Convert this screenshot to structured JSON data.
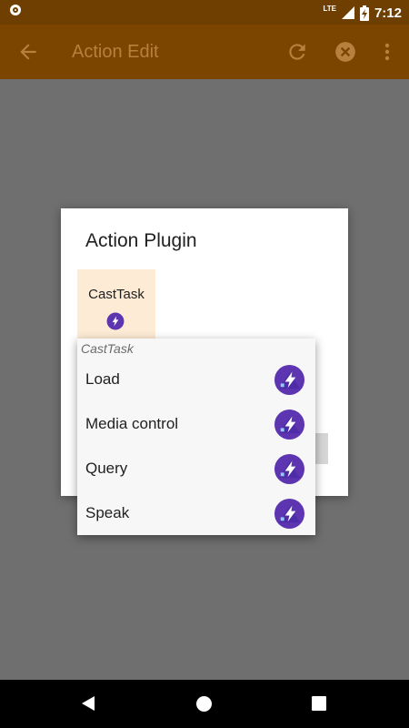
{
  "status_bar": {
    "network": "LTE",
    "time": "7:12"
  },
  "app_bar": {
    "title": "Action Edit",
    "icons": [
      "back-arrow-icon",
      "undo-icon",
      "cancel-icon",
      "more-vert-icon"
    ]
  },
  "dialog": {
    "title": "Action Plugin",
    "plugin_tile": {
      "label": "CastTask",
      "icon": "plugin-icon"
    }
  },
  "popup": {
    "header": "CastTask",
    "items": [
      {
        "label": "Load",
        "icon": "plugin-icon"
      },
      {
        "label": "Media control",
        "icon": "plugin-icon"
      },
      {
        "label": "Query",
        "icon": "plugin-icon"
      },
      {
        "label": "Speak",
        "icon": "plugin-icon"
      }
    ]
  },
  "colors": {
    "app_bar": "#7b4500",
    "status_bar": "#6e3f00",
    "scrim": "#6f6f6f",
    "tile_highlight": "#fdebd5",
    "plugin_icon_purple": "#5e35b1"
  }
}
